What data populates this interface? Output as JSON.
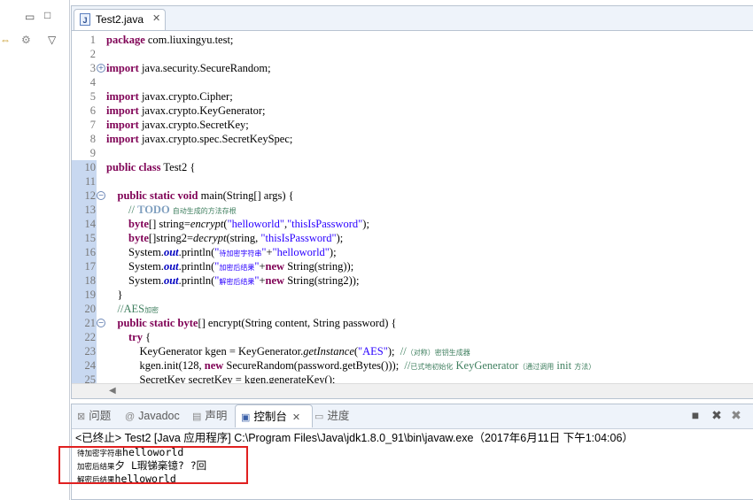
{
  "editor": {
    "tab_title": "Test2.java",
    "tab_icon": "java-file-icon",
    "lines": [
      {
        "n": "1",
        "html": "<span class='kw'>package</span> com.liuxingyu.test;"
      },
      {
        "n": "2",
        "html": ""
      },
      {
        "n": "3",
        "fold": "+",
        "html": "<span class='kw'>import</span> java.security.SecureRandom;"
      },
      {
        "n": "4",
        "html": ""
      },
      {
        "n": "5",
        "html": "<span class='kw'>import</span> javax.crypto.Cipher;"
      },
      {
        "n": "6",
        "html": "<span class='kw'>import</span> javax.crypto.KeyGenerator;"
      },
      {
        "n": "7",
        "html": "<span class='kw'>import</span> javax.crypto.SecretKey;"
      },
      {
        "n": "8",
        "html": "<span class='kw'>import</span> javax.crypto.spec.SecretKeySpec;"
      },
      {
        "n": "9",
        "html": ""
      },
      {
        "n": "10",
        "bar": true,
        "html": "<span class='kw'>public class</span> Test2 {"
      },
      {
        "n": "11",
        "bar": true,
        "html": ""
      },
      {
        "n": "12",
        "bar": true,
        "fold": "-",
        "html": "    <span class='kw'>public static void</span> main(String[] args) {"
      },
      {
        "n": "13",
        "bar": true,
        "html": "        <span class='cm'>// </span><span class='cmk'>TODO</span> <span class='cm small'>自动生成的方法存根</span>"
      },
      {
        "n": "14",
        "bar": true,
        "html": "        <span class='kw'>byte</span>[] string=<span class='it'>encrypt</span>(<span class='str'>\"helloworld\"</span>,<span class='str'>\"thisIsPassword\"</span>);"
      },
      {
        "n": "15",
        "bar": true,
        "html": "        <span class='kw'>byte</span>[]string2=<span class='it'>decrypt</span>(string, <span class='str'>\"thisIsPassword\"</span>);"
      },
      {
        "n": "16",
        "bar": true,
        "html": "        System.<span class='fld'>out</span>.println(<span class='str'>\"<span class='small'>待加密字符串</span>\"</span>+<span class='str'>\"helloworld\"</span>);"
      },
      {
        "n": "17",
        "bar": true,
        "html": "        System.<span class='fld'>out</span>.println(<span class='str'>\"<span class='small'>加密后结果</span>\"</span>+<span class='kw'>new</span> String(string));"
      },
      {
        "n": "18",
        "bar": true,
        "html": "        System.<span class='fld'>out</span>.println(<span class='str'>\"<span class='small'>解密后结果</span>\"</span>+<span class='kw'>new</span> String(string2));"
      },
      {
        "n": "19",
        "bar": true,
        "html": "    }"
      },
      {
        "n": "20",
        "bar": true,
        "html": "    <span class='cm'>//AES<span class='small'>加密</span></span>"
      },
      {
        "n": "21",
        "bar": true,
        "fold": "-",
        "html": "    <span class='kw'>public static byte</span>[] encrypt(String content, String password) {"
      },
      {
        "n": "22",
        "bar": true,
        "html": "        <span class='kw'>try</span> {"
      },
      {
        "n": "23",
        "bar": true,
        "html": "            KeyGenerator kgen = KeyGenerator.<span class='it'>getInstance</span>(<span class='str'>\"AES\"</span>);  <span class='cm'>//<span class='small'>（对称）密钥生成器</span></span>"
      },
      {
        "n": "24",
        "bar": true,
        "html": "            kgen.init(128, <span class='kw'>new</span> SecureRandom(password.getBytes()));  <span class='cm'>//<span class='small'>已式地初始化</span> KeyGenerator<span class='small'>（通过调用</span> init <span class='small'>方法）</span></span>"
      },
      {
        "n": "25",
        "bar": true,
        "html": "            SecretKey secretKey = kgen.generateKey();"
      }
    ]
  },
  "panel": {
    "tabs": [
      {
        "icon": "problems-icon",
        "label": "问题"
      },
      {
        "icon": "javadoc-icon",
        "label": "Javadoc"
      },
      {
        "icon": "declaration-icon",
        "label": "声明"
      },
      {
        "icon": "console-icon",
        "label": "控制台"
      },
      {
        "icon": "progress-icon",
        "label": "进度"
      }
    ],
    "status": "<已终止> Test2 [Java 应用程序] C:\\Program Files\\Java\\jdk1.8.0_91\\bin\\javaw.exe（2017年6月11日 下午1:04:06）",
    "output": [
      {
        "prefix": "待加密字符串",
        "value": "helloworld"
      },
      {
        "prefix": "加密后结果",
        "value": "夕 L瑕锑稁镱? ?回"
      },
      {
        "prefix": "解密后结果",
        "value": "helloworld"
      }
    ]
  }
}
